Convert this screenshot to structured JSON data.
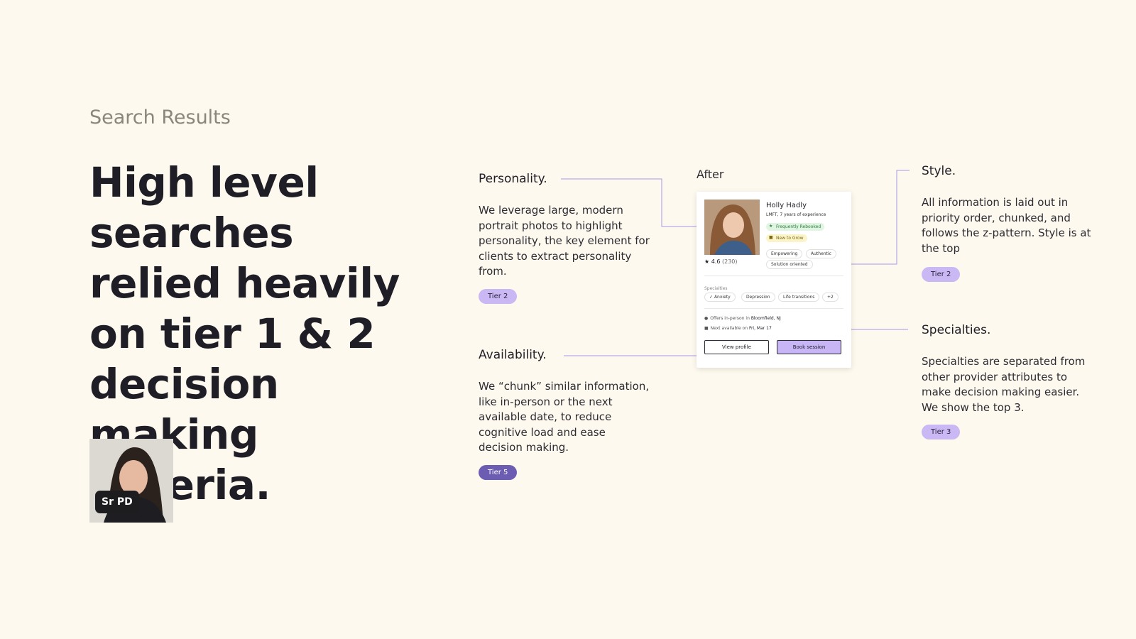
{
  "section_label": "Search Results",
  "headline": "High level searches relied heavily on tier 1 & 2 decision making criteria.",
  "author": {
    "role": "Sr PD"
  },
  "card_label": "After",
  "annotations": {
    "personality": {
      "title": "Personality.",
      "body": "We leverage large, modern portrait photos to highlight personality, the key element for clients to extract personality from.",
      "tier": "Tier 2"
    },
    "availability": {
      "title": "Availability.",
      "body": "We “chunk” similar information, like in-person or the next available date, to reduce cognitive load and ease decision making.",
      "tier": "Tier 5"
    },
    "style": {
      "title": "Style.",
      "body": "All information is laid out in priority order, chunked, and follows the z-pattern. Style is at the top",
      "tier": "Tier 2"
    },
    "specialties": {
      "title": "Specialties.",
      "body": "Specialties are separated from other provider attributes to make decision making easier. We show the top 3.",
      "tier": "Tier 3"
    }
  },
  "provider_card": {
    "name": "Holly Hadly",
    "credentials": "LMFT, 7 years of experience",
    "badges": [
      {
        "label": "Frequently Rebooked",
        "icon": "star-icon"
      },
      {
        "label": "New to Grow",
        "icon": "sprout-icon"
      }
    ],
    "rating": "4.6",
    "rating_count": "(230)",
    "style_tags": [
      "Empowering",
      "Authentic",
      "Solution oriented"
    ],
    "specialties_label": "Specialties",
    "specialties": [
      "Anxiety",
      "Depression",
      "Life transitions",
      "+2"
    ],
    "in_person_prefix": "Offers in-person in",
    "in_person_location": "Bloomfield, NJ",
    "availability_prefix": "Next available on",
    "availability_date": "Fri, Mar 17",
    "buttons": {
      "view_profile": "View profile",
      "book_session": "Book session"
    }
  },
  "colors": {
    "background": "#fef9ee",
    "accent_purple": "#c7b5f5",
    "connector": "#a796e8",
    "tier_dark": "#6c5db3"
  }
}
